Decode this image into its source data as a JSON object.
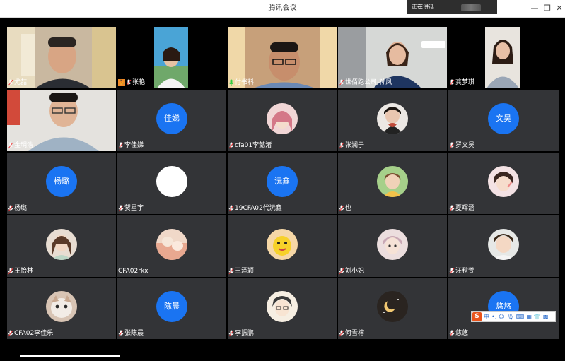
{
  "window": {
    "title": "腾讯会议",
    "speaking_label": "正在讲话:"
  },
  "participants": [
    {
      "name": "尤喆",
      "type": "video",
      "mic": "on"
    },
    {
      "name": "张艳",
      "type": "video",
      "mic": "on"
    },
    {
      "name": "付书科",
      "type": "video",
      "mic": "active"
    },
    {
      "name": "世佰跑公司-孙凤",
      "type": "video",
      "mic": "on"
    },
    {
      "name": "龚梦琪",
      "type": "video",
      "mic": "on"
    },
    {
      "name": "金明浩",
      "type": "video",
      "mic": "on"
    },
    {
      "name": "李佳娣",
      "type": "initials",
      "initials": "佳娣",
      "mic": "on"
    },
    {
      "name": "cfa01李懿渚",
      "type": "image",
      "mic": "on"
    },
    {
      "name": "张澜于",
      "type": "image",
      "mic": "on"
    },
    {
      "name": "罗文昊",
      "type": "initials",
      "initials": "文昊",
      "mic": "on"
    },
    {
      "name": "杨璐",
      "type": "initials",
      "initials": "杨璐",
      "mic": "on"
    },
    {
      "name": "贺星宇",
      "type": "image",
      "mic": "on"
    },
    {
      "name": "19CFA02代沅鑫",
      "type": "initials",
      "initials": "沅鑫",
      "mic": "on"
    },
    {
      "name": "也",
      "type": "image",
      "mic": "on"
    },
    {
      "name": "夏晖涵",
      "type": "image",
      "mic": "on"
    },
    {
      "name": "王怡林",
      "type": "image",
      "mic": "on"
    },
    {
      "name": "CFA02rkx",
      "type": "image",
      "mic": "none"
    },
    {
      "name": "王泽颖",
      "type": "image",
      "mic": "on"
    },
    {
      "name": "刘小妃",
      "type": "image",
      "mic": "on"
    },
    {
      "name": "汪秋萱",
      "type": "image",
      "mic": "on"
    },
    {
      "name": "CFA02李佳乐",
      "type": "image",
      "mic": "on"
    },
    {
      "name": "张陈晨",
      "type": "initials",
      "initials": "陈晨",
      "mic": "on"
    },
    {
      "name": "李振鹏",
      "type": "image",
      "mic": "on"
    },
    {
      "name": "何雪榕",
      "type": "image",
      "mic": "on"
    },
    {
      "name": "悠悠",
      "type": "initials",
      "initials": "悠悠",
      "mic": "on"
    }
  ],
  "ime": {
    "logo": "S",
    "mode": "中"
  },
  "colors": {
    "avatar_blue": "#1a74f2",
    "tile_bg": "#333437",
    "mic_active": "#2ecc40"
  }
}
